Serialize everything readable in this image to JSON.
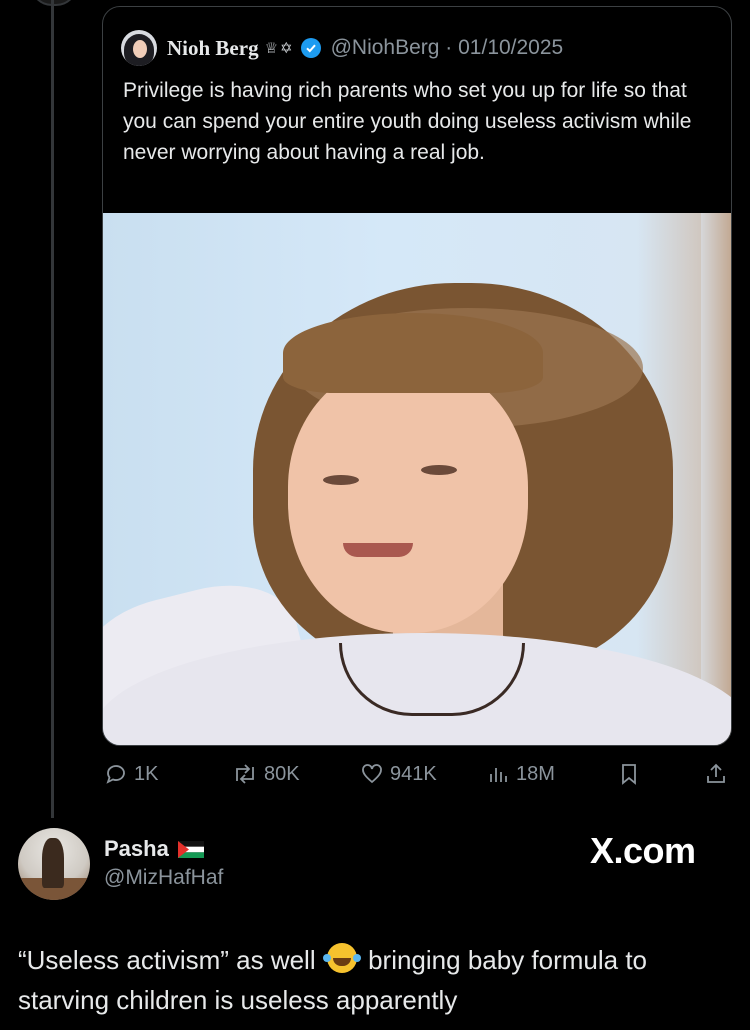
{
  "quoted_post": {
    "author_name": "Nioh Berg",
    "name_emojis": "♕✡",
    "handle_date": "@NiohBerg · 01/10/2025",
    "text": "Privilege is having rich parents who set you up for life so that you can spend your entire youth doing useless activism while never worrying about having a real job."
  },
  "actions": {
    "replies": "1K",
    "reposts": "80K",
    "likes": "941K",
    "views": "18M"
  },
  "reply": {
    "name": "Pasha",
    "handle": "@MizHafHaf",
    "watermark": "X.com",
    "text_before_emoji": "“Useless activism” as well",
    "text_after_emoji": "bringing baby formula to starving children is useless apparently"
  },
  "colors": {
    "background": "#000000",
    "text": "#e7e9ea",
    "muted": "#8b949c",
    "verified": "#1d9bf0",
    "border": "#3c4043"
  },
  "icons": [
    "verified-badge-icon",
    "reply-icon",
    "repost-icon",
    "like-icon",
    "views-icon",
    "bookmark-icon",
    "share-icon",
    "palestine-flag-icon",
    "laughing-emoji-icon"
  ]
}
